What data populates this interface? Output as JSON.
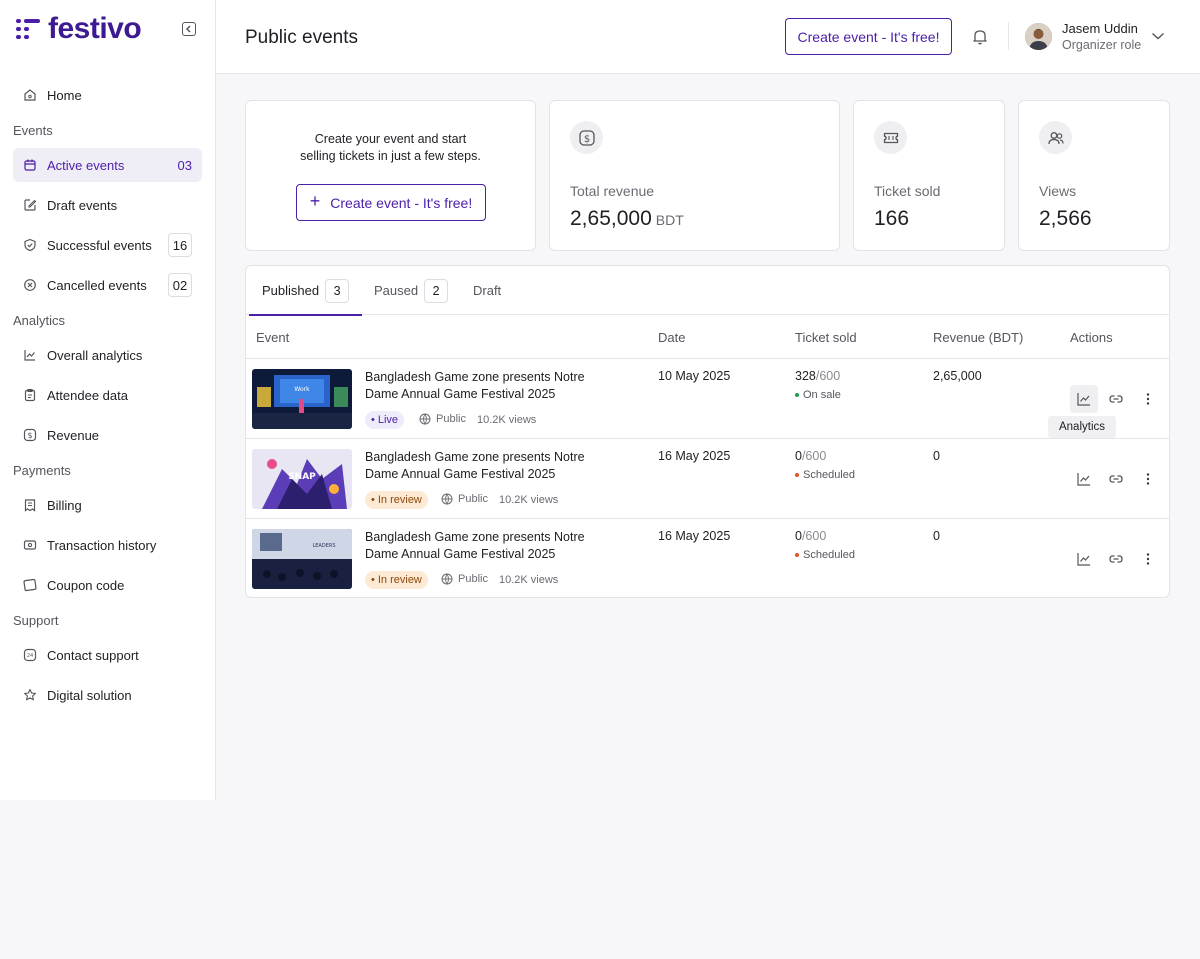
{
  "app": {
    "name": "festivo"
  },
  "sidebar": {
    "home": "Home",
    "sections": {
      "events": "Events",
      "analytics": "Analytics",
      "payments": "Payments",
      "support": "Support"
    },
    "events": [
      {
        "label": "Active events",
        "count": "03"
      },
      {
        "label": "Draft events",
        "count": ""
      },
      {
        "label": "Successful events",
        "count": "16"
      },
      {
        "label": "Cancelled events",
        "count": "02"
      }
    ],
    "analytics": [
      {
        "label": "Overall analytics"
      },
      {
        "label": "Attendee data"
      },
      {
        "label": "Revenue"
      }
    ],
    "payments": [
      {
        "label": "Billing"
      },
      {
        "label": "Transaction history"
      },
      {
        "label": "Coupon code"
      }
    ],
    "support": [
      {
        "label": "Contact support"
      },
      {
        "label": "Digital solution"
      }
    ]
  },
  "header": {
    "title": "Public events",
    "create_label": "Create event - It's free!",
    "user": {
      "name": "Jasem Uddin",
      "role": "Organizer role"
    }
  },
  "promo": {
    "text": "Create your event and start selling tickets in just a few steps.",
    "button_label": "Create event - It's free!"
  },
  "stats": {
    "revenue": {
      "label": "Total revenue",
      "value": "2,65,000",
      "unit": "BDT"
    },
    "tickets": {
      "label": "Ticket sold",
      "value": "166"
    },
    "views": {
      "label": "Views",
      "value": "2,566"
    }
  },
  "tabs": [
    {
      "label": "Published",
      "count": "3"
    },
    {
      "label": "Paused",
      "count": "2"
    },
    {
      "label": "Draft",
      "count": ""
    }
  ],
  "table": {
    "columns": {
      "event": "Event",
      "date": "Date",
      "sold": "Ticket sold",
      "revenue": "Revenue (BDT)",
      "actions": "Actions"
    },
    "rows": [
      {
        "title": "Bangladesh Game zone presents Notre Dame Annual Game Festival 2025",
        "badge": "Live",
        "visibility": "Public",
        "views": "10.2K views",
        "date": "10 May 2025",
        "sold": "328",
        "total": "/600",
        "status": "On sale",
        "revenue": "2,65,000"
      },
      {
        "title": "Bangladesh Game zone presents Notre Dame Annual Game Festival 2025",
        "badge": "In review",
        "visibility": "Public",
        "views": "10.2K views",
        "date": "16 May 2025",
        "sold": "0",
        "total": "/600",
        "status": "Scheduled",
        "revenue": "0"
      },
      {
        "title": "Bangladesh Game zone presents Notre Dame Annual Game Festival 2025",
        "badge": "In review",
        "visibility": "Public",
        "views": "10.2K views",
        "date": "16 May 2025",
        "sold": "0",
        "total": "/600",
        "status": "Scheduled",
        "revenue": "0"
      }
    ]
  },
  "tooltip": "Analytics",
  "colors": {
    "brand": "#4b1fa8",
    "live_bg": "#f0ebfb",
    "review_bg": "#fde9d4",
    "on_sale": "#1f9d55",
    "scheduled": "#e0522b"
  }
}
